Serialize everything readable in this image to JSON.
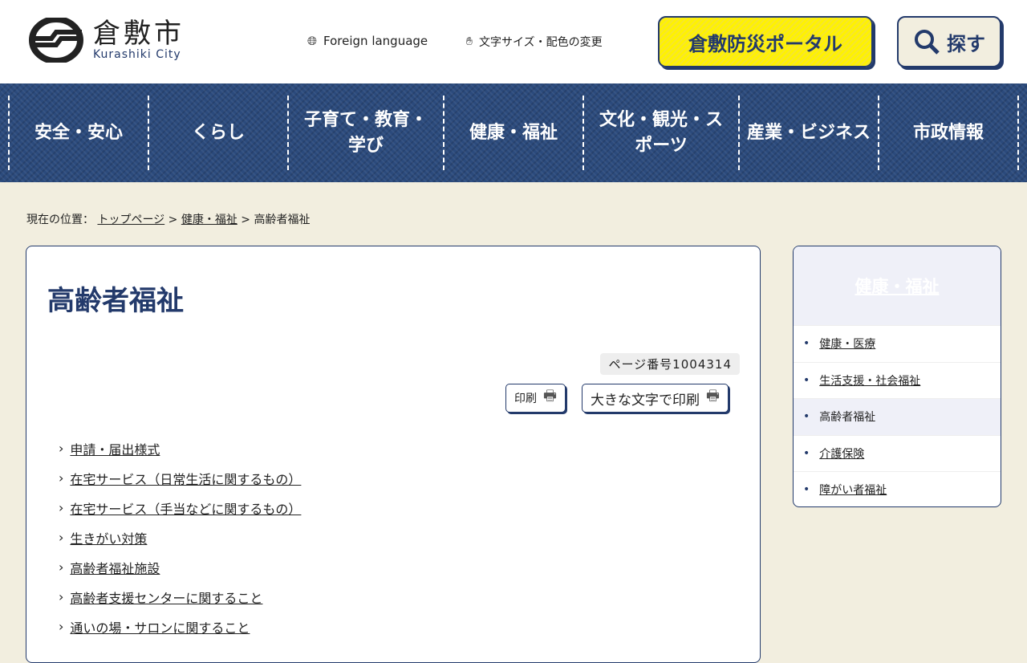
{
  "header": {
    "logo_jp": "倉敷市",
    "logo_en": "Kurashiki City",
    "foreign": "Foreign language",
    "textsize": "文字サイズ・配色の変更",
    "portal": "倉敷防災ポータル",
    "search": "探す"
  },
  "nav": [
    "安全・安心",
    "くらし",
    "子育て・教育・学び",
    "健康・福祉",
    "文化・観光・スポーツ",
    "産業・ビジネス",
    "市政情報"
  ],
  "breadcrumb": {
    "label": "現在の位置：",
    "items": [
      "トップページ",
      "健康・福祉"
    ],
    "current": "高齢者福祉"
  },
  "main": {
    "title": "高齢者福祉",
    "page_number": "ページ番号1004314",
    "print": "印刷",
    "print_large": "大きな文字で印刷",
    "links": [
      "申請・届出様式",
      "在宅サービス（日常生活に関するもの）",
      "在宅サービス（手当などに関するもの）",
      "生きがい対策",
      "高齢者福祉施設",
      "高齢者支援センターに関すること",
      "通いの場・サロンに関すること"
    ]
  },
  "side": {
    "title": "健康・福祉",
    "items": [
      "健康・医療",
      "生活支援・社会福祉",
      "高齢者福祉",
      "介護保険",
      "障がい者福祉"
    ]
  }
}
